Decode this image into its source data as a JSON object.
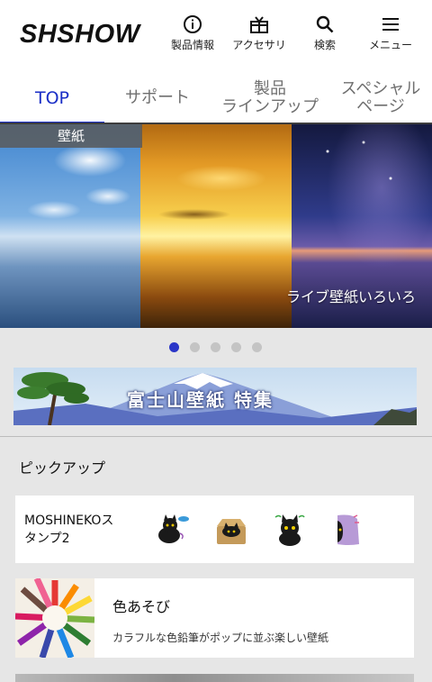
{
  "header": {
    "logo": "SHSHOW",
    "nav": [
      {
        "label": "製品情報",
        "icon": "info-icon"
      },
      {
        "label": "アクセサリ",
        "icon": "gift-icon"
      },
      {
        "label": "検索",
        "icon": "search-icon"
      },
      {
        "label": "メニュー",
        "icon": "hamburger-menu-icon"
      }
    ]
  },
  "tabs": [
    {
      "line1": "TOP",
      "line2": "",
      "active": true
    },
    {
      "line1": "サポート",
      "line2": "",
      "active": false
    },
    {
      "line1": "製品",
      "line2": "ラインアップ",
      "active": false
    },
    {
      "line1": "スペシャル",
      "line2": "ページ",
      "active": false
    }
  ],
  "banner": {
    "tag": "壁紙",
    "caption": "ライブ壁紙いろいろ"
  },
  "carousel": {
    "count": 5,
    "active_index": 0
  },
  "feature_banner": {
    "title": "富士山壁紙 特集"
  },
  "pickup": {
    "title": "ピックアップ",
    "items": [
      {
        "name_line1": "MOSHINEKOス",
        "name_line2": "タンプ2",
        "stickers": [
          "cat-sticker-fish",
          "cat-sticker-box",
          "cat-sticker-curious",
          "cat-sticker-peek"
        ]
      },
      {
        "title": "色あそび",
        "description": "カラフルな色鉛筆がポップに並ぶ楽しい壁紙"
      }
    ]
  },
  "colors": {
    "accent": "#1a2ec6",
    "dot_active": "#2a36c8",
    "dot_inactive": "#c4c4c4"
  }
}
